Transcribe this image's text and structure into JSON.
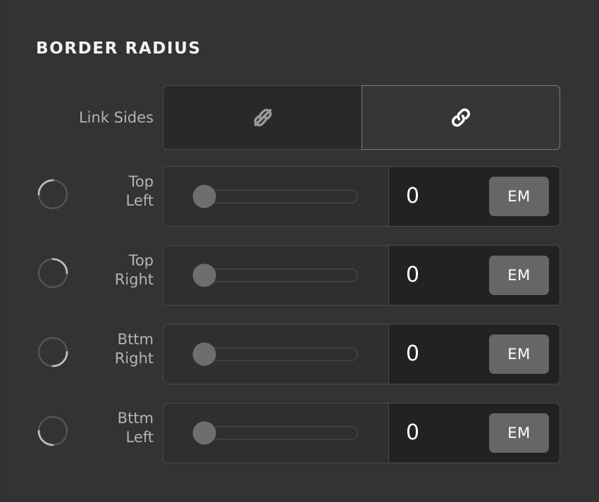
{
  "section": {
    "title": "BORDER RADIUS"
  },
  "colors": {
    "background": "#333333",
    "panel_dark": "#222222",
    "control_bg": "#2f2f2f",
    "border": "#4a4a4a",
    "border_active": "#7d7d7d",
    "label_text": "#b4b4b4",
    "value_text": "#ffffff",
    "unit_bg": "#666666",
    "thumb": "#6e6e6e",
    "icon_inactive": "#999999",
    "icon_active": "#ffffff",
    "arc_highlight": "#b9b9b9",
    "arc_base": "#555555"
  },
  "link_sides": {
    "label": "Link Sides",
    "options": [
      {
        "id": "unlinked",
        "icon": "unlink-icon",
        "selected": false
      },
      {
        "id": "linked",
        "icon": "link-icon",
        "selected": true
      }
    ]
  },
  "corners": [
    {
      "id": "top-left",
      "label_line1": "Top",
      "label_line2": "Left",
      "icon": "corner-top-left-icon",
      "slider": {
        "value": 0,
        "min": 0,
        "max": 100,
        "percent": 0
      },
      "value": "0",
      "unit": "EM"
    },
    {
      "id": "top-right",
      "label_line1": "Top",
      "label_line2": "Right",
      "icon": "corner-top-right-icon",
      "slider": {
        "value": 0,
        "min": 0,
        "max": 100,
        "percent": 0
      },
      "value": "0",
      "unit": "EM"
    },
    {
      "id": "bottom-right",
      "label_line1": "Bttm",
      "label_line2": "Right",
      "icon": "corner-bottom-right-icon",
      "slider": {
        "value": 0,
        "min": 0,
        "max": 100,
        "percent": 0
      },
      "value": "0",
      "unit": "EM"
    },
    {
      "id": "bottom-left",
      "label_line1": "Bttm",
      "label_line2": "Left",
      "icon": "corner-bottom-left-icon",
      "slider": {
        "value": 0,
        "min": 0,
        "max": 100,
        "percent": 0
      },
      "value": "0",
      "unit": "EM"
    }
  ]
}
